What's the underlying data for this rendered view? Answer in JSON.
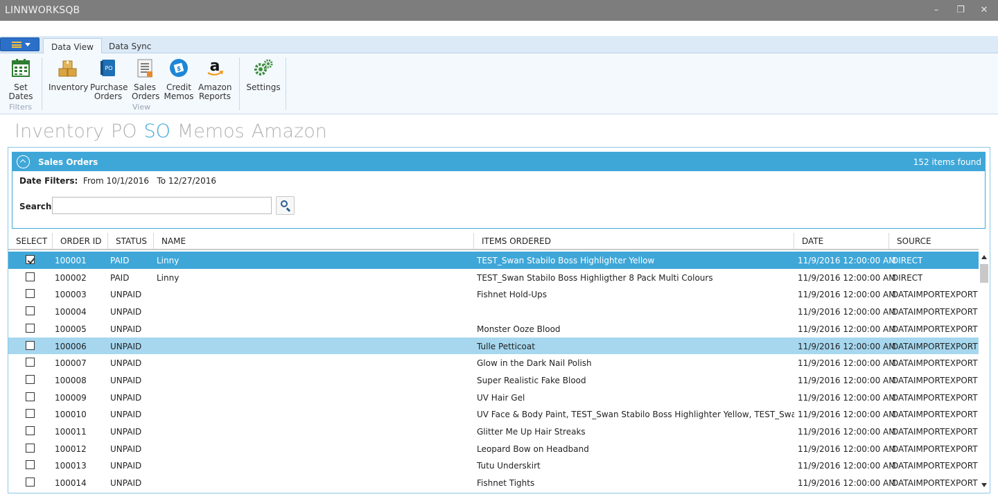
{
  "window": {
    "title": "LINNWORKSQB",
    "minimize": "–",
    "restore": "❐",
    "close": "✕"
  },
  "ribbon": {
    "tabs": [
      {
        "label": "Data View"
      },
      {
        "label": "Data Sync"
      }
    ],
    "buttons": {
      "set_dates": {
        "line1": "Set",
        "line2": "Dates",
        "icon": "calendar-icon"
      },
      "inventory": {
        "line1": "Inventory",
        "line2": "",
        "icon": "boxes-icon"
      },
      "purchase_orders": {
        "line1": "Purchase",
        "line2": "Orders",
        "icon": "po-book-icon"
      },
      "sales_orders": {
        "line1": "Sales",
        "line2": "Orders",
        "icon": "document-list-icon"
      },
      "credit_memos": {
        "line1": "Credit",
        "line2": "Memos",
        "icon": "credit-memo-icon"
      },
      "amazon_reports": {
        "line1": "Amazon",
        "line2": "Reports",
        "icon": "amazon-icon"
      },
      "settings": {
        "line1": "Settings",
        "line2": "",
        "icon": "gears-icon"
      }
    },
    "groups": {
      "filters": "Filters",
      "view": "View"
    }
  },
  "section_nav": [
    "Inventory",
    "PO",
    "SO",
    "Memos",
    "Amazon"
  ],
  "panel": {
    "title": "Sales Orders",
    "count": "152 items found",
    "date_filter_label": "Date Filters:",
    "date_from": "From 10/1/2016",
    "date_to": "To 12/27/2016",
    "search_label": "Search:",
    "search_value": ""
  },
  "grid": {
    "columns": [
      "SELECT",
      "ORDER ID",
      "STATUS",
      "NAME",
      "ITEMS ORDERED",
      "DATE",
      "SOURCE"
    ],
    "rows": [
      {
        "checked": true,
        "id": "100001",
        "status": "PAID",
        "name": "Linny",
        "items": "TEST_Swan Stabilo Boss Highlighter Yellow",
        "date": "11/9/2016 12:00:00 AM",
        "source": "DIRECT"
      },
      {
        "checked": false,
        "id": "100002",
        "status": "PAID",
        "name": "Linny",
        "items": "TEST_Swan Stabilo Boss Highligther 8 Pack Multi Colours",
        "date": "11/9/2016 12:00:00 AM",
        "source": "DIRECT"
      },
      {
        "checked": false,
        "id": "100003",
        "status": "UNPAID",
        "name": "",
        "items": "Fishnet Hold-Ups",
        "date": "11/9/2016 12:00:00 AM",
        "source": "DATAIMPORTEXPORT"
      },
      {
        "checked": false,
        "id": "100004",
        "status": "UNPAID",
        "name": "",
        "items": "",
        "date": "11/9/2016 12:00:00 AM",
        "source": "DATAIMPORTEXPORT"
      },
      {
        "checked": false,
        "id": "100005",
        "status": "UNPAID",
        "name": "",
        "items": "Monster Ooze Blood",
        "date": "11/9/2016 12:00:00 AM",
        "source": "DATAIMPORTEXPORT"
      },
      {
        "checked": false,
        "id": "100006",
        "status": "UNPAID",
        "name": "",
        "items": "Tulle Petticoat",
        "date": "11/9/2016 12:00:00 AM",
        "source": "DATAIMPORTEXPORT"
      },
      {
        "checked": false,
        "id": "100007",
        "status": "UNPAID",
        "name": "",
        "items": "Glow in the Dark Nail Polish",
        "date": "11/9/2016 12:00:00 AM",
        "source": "DATAIMPORTEXPORT"
      },
      {
        "checked": false,
        "id": "100008",
        "status": "UNPAID",
        "name": "",
        "items": "Super Realistic Fake Blood",
        "date": "11/9/2016 12:00:00 AM",
        "source": "DATAIMPORTEXPORT"
      },
      {
        "checked": false,
        "id": "100009",
        "status": "UNPAID",
        "name": "",
        "items": "UV Hair Gel",
        "date": "11/9/2016 12:00:00 AM",
        "source": "DATAIMPORTEXPORT"
      },
      {
        "checked": false,
        "id": "100010",
        "status": "UNPAID",
        "name": "",
        "items": "UV Face & Body Paint, TEST_Swan Stabilo Boss Highlighter Yellow, TEST_Swan Stal",
        "date": "11/9/2016 12:00:00 AM",
        "source": "DATAIMPORTEXPORT"
      },
      {
        "checked": false,
        "id": "100011",
        "status": "UNPAID",
        "name": "",
        "items": "Glitter Me Up Hair Streaks",
        "date": "11/9/2016 12:00:00 AM",
        "source": "DATAIMPORTEXPORT"
      },
      {
        "checked": false,
        "id": "100012",
        "status": "UNPAID",
        "name": "",
        "items": "Leopard Bow on Headband",
        "date": "11/9/2016 12:00:00 AM",
        "source": "DATAIMPORTEXPORT"
      },
      {
        "checked": false,
        "id": "100013",
        "status": "UNPAID",
        "name": "",
        "items": "Tutu Underskirt",
        "date": "11/9/2016 12:00:00 AM",
        "source": "DATAIMPORTEXPORT"
      },
      {
        "checked": false,
        "id": "100014",
        "status": "UNPAID",
        "name": "",
        "items": "Fishnet Tights",
        "date": "11/9/2016 12:00:00 AM",
        "source": "DATAIMPORTEXPORT"
      }
    ]
  },
  "colors": {
    "accent": "#3fa7d8",
    "selected_row": "#3fa7d8",
    "hover_row": "#a6d7ee",
    "titlebar": "#7d7d7d",
    "nav_inactive": "#b2b2b2"
  }
}
